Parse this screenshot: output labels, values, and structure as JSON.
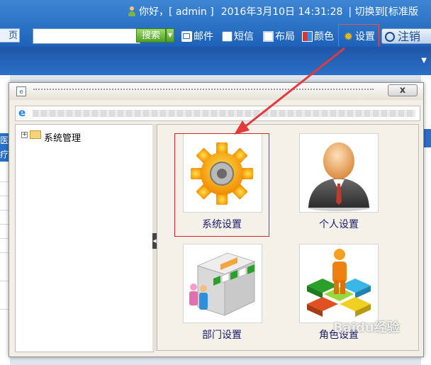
{
  "header": {
    "greeting": "你好，[ admin ]",
    "datetime": "2016年3月10日 14:31:28",
    "switch_text": "| 切换到[标准版"
  },
  "toolbar": {
    "home_label": "页",
    "search_placeholder": "",
    "search_button": "搜索",
    "mail_label": "邮件",
    "sms_label": "短信",
    "layout_label": "布局",
    "color_label": "颜色",
    "settings_label": "设置",
    "logout_label": "注销"
  },
  "background": {
    "left_tab_text": "医疗 医"
  },
  "dialog": {
    "close_label": "x",
    "tree": {
      "root_label": "系统管理",
      "expand_glyph": "+"
    },
    "cards": [
      {
        "label": "系统设置"
      },
      {
        "label": "个人设置"
      },
      {
        "label": "部门设置"
      },
      {
        "label": "角色设置"
      }
    ]
  },
  "watermark": "Baidu经验",
  "colors": {
    "header_blue": "#2a6fc8",
    "highlight_red": "#cc2a2a",
    "search_green": "#4e9f26",
    "gear_orange": "#f5a400"
  }
}
